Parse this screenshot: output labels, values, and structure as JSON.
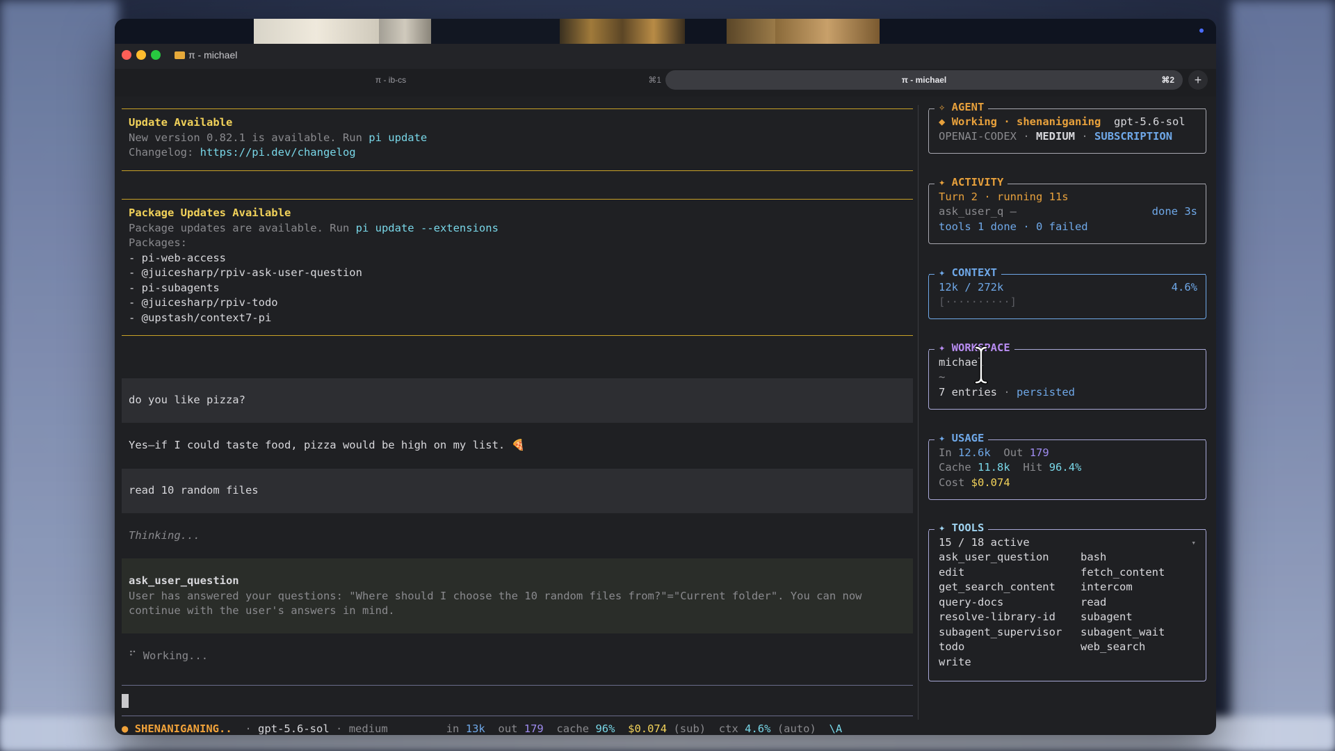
{
  "window": {
    "title": "π - michael",
    "tabs": [
      {
        "label": "π - ib-cs",
        "shortcut": "⌘1"
      },
      {
        "label": "π - michael",
        "shortcut": "⌘2"
      }
    ],
    "new_tab": "+"
  },
  "main": {
    "update": {
      "title": "Update Available",
      "line1_prefix": "New version 0.82.1 is available. Run ",
      "line1_cmd": "pi update",
      "line2_prefix": "Changelog: ",
      "line2_url": "https://pi.dev/changelog"
    },
    "packages": {
      "title": "Package Updates Available",
      "line1_prefix": "Package updates are available. Run ",
      "line1_cmd": "pi update --extensions",
      "label": "Packages:",
      "items": [
        "- pi-web-access",
        "- @juicesharp/rpiv-ask-user-question",
        "- pi-subagents",
        "- @juicesharp/rpiv-todo",
        "- @upstash/context7-pi"
      ]
    },
    "messages": {
      "user1": "do you like pizza?",
      "assistant1": "Yes—if I could taste food, pizza would be high on my list. 🍕",
      "user2": "read 10 random files",
      "thinking": "Thinking...",
      "tool_name": "ask_user_question",
      "tool_line1": "User has answered your questions: \"Where should I choose the 10 random files from?\"=\"Current folder\". You can now",
      "tool_line2": "continue with the user's answers in mind.",
      "spinner": "⠋",
      "working": "Working..."
    }
  },
  "status": {
    "dot": "●",
    "state": "SHENANIGANING..",
    "model": "gpt-5.6-sol",
    "effort": "medium",
    "in_label": "in",
    "in_val": "13k",
    "out_label": "out",
    "out_val": "179",
    "cache_label": "cache",
    "cache_val": "96%",
    "cost": "$0.074",
    "cost_note": "(sub)",
    "ctx_label": "ctx",
    "ctx_val": "4.6%",
    "ctx_note": "(auto)",
    "kbd": "\\A"
  },
  "sidebar": {
    "agent": {
      "title": "✧ AGENT",
      "status_icon": "◆",
      "status": "Working · shenaniganing",
      "model": "gpt-5.6-sol",
      "provider": "OPENAI-CODEX",
      "sep": "·",
      "effort": "MEDIUM",
      "plan": "SUBSCRIPTION"
    },
    "activity": {
      "title": "✦ ACTIVITY",
      "turn": "Turn 2 · running 11s",
      "tool": "ask_user_q —",
      "tool_status": "done 3s",
      "summary": "tools 1 done · 0 failed"
    },
    "context": {
      "title": "✦ CONTEXT",
      "used": "12k / 272k",
      "pct": "4.6%",
      "bar": "[··········]"
    },
    "workspace": {
      "title": "✦ WORKSPACE",
      "name": "michael",
      "path": "~",
      "entries": "7 entries",
      "sep": "·",
      "persisted": "persisted"
    },
    "usage": {
      "title": "✦ USAGE",
      "in_label": "In",
      "in_val": "12.6k",
      "out_label": "Out",
      "out_val": "179",
      "cache_label": "Cache",
      "cache_val": "11.8k",
      "hit_label": "Hit",
      "hit_val": "96.4%",
      "cost_label": "Cost",
      "cost_val": "$0.074"
    },
    "tools": {
      "title": "✦ TOOLS",
      "active": "15 / 18 active",
      "caret": "▾",
      "left": [
        "ask_user_question",
        "edit",
        "get_search_content",
        "query-docs",
        "resolve-library-id",
        "subagent_supervisor",
        "todo",
        "write"
      ],
      "right": [
        "bash",
        "fetch_content",
        "intercom",
        "read",
        "subagent",
        "subagent_wait",
        "web_search"
      ]
    }
  },
  "colors": {
    "agent": "#e8a13c",
    "activity": "#e8a13c",
    "context": "#6fa8e8",
    "workspace": "#b78cf0",
    "usage": "#6fa8e8",
    "tools": "#9fd3f0",
    "accent_yellow": "#f2d25a",
    "status_orange": "#f0a23a"
  }
}
